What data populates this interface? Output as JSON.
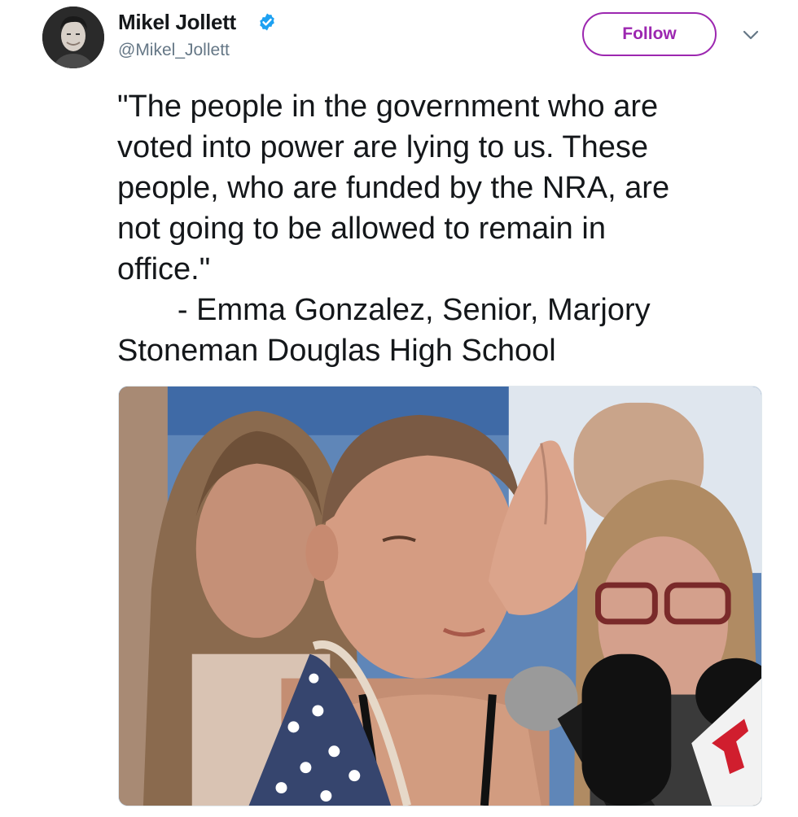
{
  "user": {
    "display_name": "Mikel Jollett",
    "handle": "@Mikel_Jollett",
    "verified": true,
    "avatar_icon": "profile-photo"
  },
  "actions": {
    "follow_label": "Follow",
    "more_icon": "chevron-down-icon"
  },
  "tweet": {
    "lines": [
      "\"The people in the government who are",
      "voted into power are lying to us. These",
      "people, who are funded by the NRA, are",
      "not going to be allowed to remain in",
      "office.\"",
      "       - Emma Gonzalez, Senior, Marjory",
      "Stoneman Douglas High School"
    ]
  },
  "media": {
    "type": "photo"
  },
  "colors": {
    "follow_accent": "#9c27b0",
    "verified_blue": "#1da1f2",
    "handle_gray": "#657786",
    "text": "#14171a"
  }
}
